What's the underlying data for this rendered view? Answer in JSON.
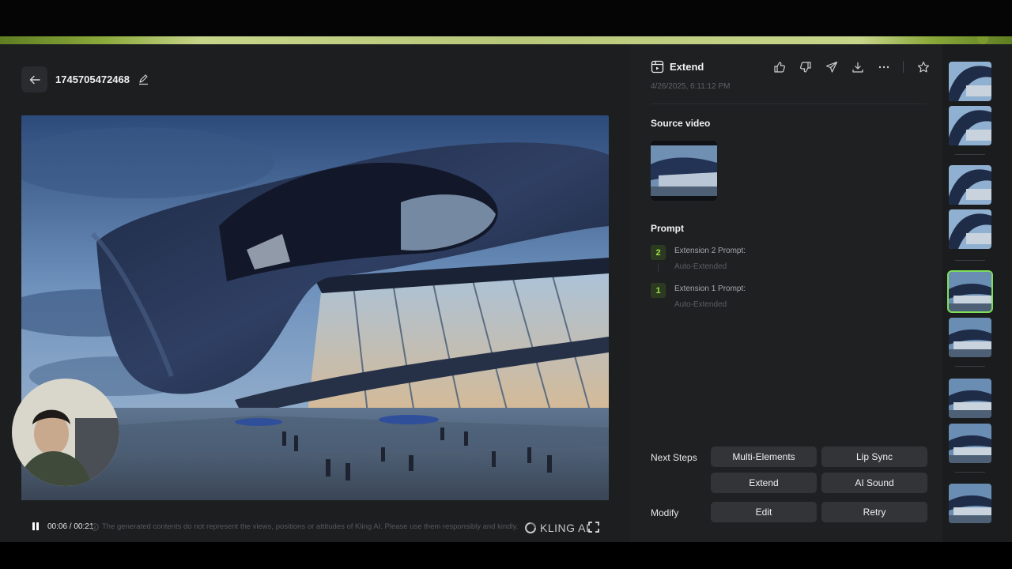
{
  "header": {
    "title": "1745705472468"
  },
  "player": {
    "time": "00:06 / 00:21",
    "progress_fraction": 0.28,
    "watermark": "KLING AI"
  },
  "disclaimer": "The generated contents do not represent the views, positions or attitudes of Kling AI. Please use them responsibly and kindly.",
  "panel": {
    "mode_label": "Extend",
    "date": "4/26/2025, 6:11:12 PM",
    "source_video_label": "Source video",
    "prompt_label": "Prompt",
    "prompts": [
      {
        "number": "2",
        "title": "Extension 2 Prompt:",
        "text": "Auto-Extended"
      },
      {
        "number": "1",
        "title": "Extension 1 Prompt:",
        "text": "Auto-Extended"
      }
    ],
    "next_steps_label": "Next Steps",
    "next_steps": [
      "Multi-Elements",
      "Lip Sync",
      "Extend",
      "AI Sound"
    ],
    "modify_label": "Modify",
    "modify": [
      "Edit",
      "Retry"
    ]
  },
  "colors": {
    "accent": "#7ee05a",
    "panel": "#1f2022",
    "button": "#323437"
  },
  "icons": [
    "back-arrow-icon",
    "pencil-icon",
    "extend-video-icon",
    "thumbs-up-icon",
    "thumbs-down-icon",
    "share-icon",
    "download-icon",
    "more-icon",
    "star-icon",
    "pause-icon",
    "fullscreen-icon",
    "info-icon"
  ]
}
